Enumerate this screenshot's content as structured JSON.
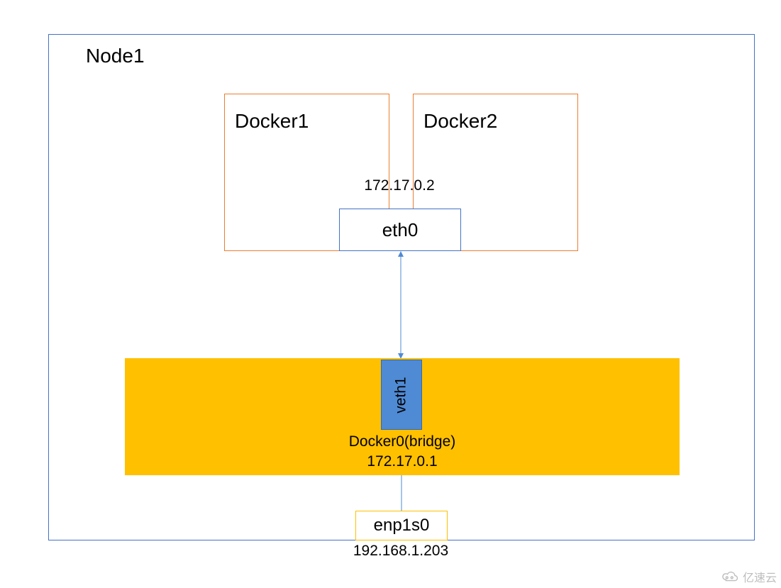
{
  "node": {
    "title": "Node1"
  },
  "containers": {
    "docker1": "Docker1",
    "docker2": "Docker2",
    "eth0_ip": "172.17.0.2",
    "eth0_label": "eth0"
  },
  "bridge": {
    "veth_label": "veth1",
    "name": "Docker0(bridge)",
    "ip": "172.17.0.1"
  },
  "host_nic": {
    "name": "enp1s0",
    "ip": "192.168.1.203"
  },
  "watermark": "亿速云"
}
